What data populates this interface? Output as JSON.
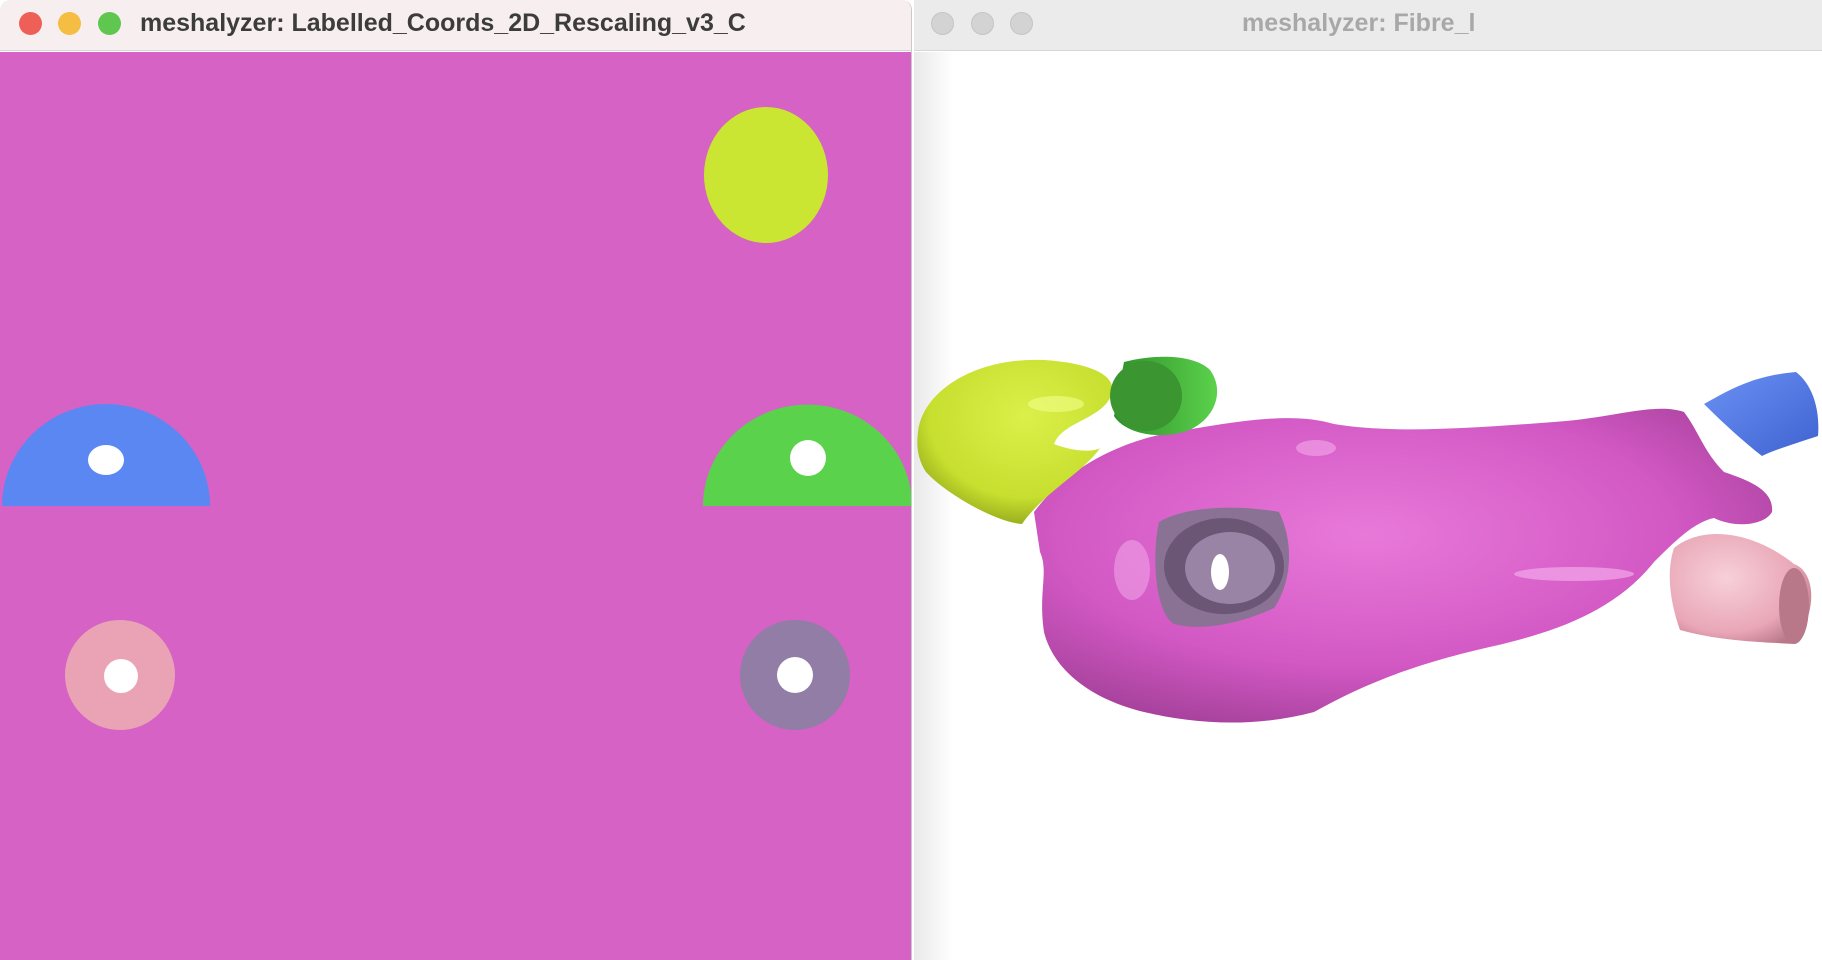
{
  "windows": {
    "left": {
      "title": "meshalyzer: Labelled_Coords_2D_Rescaling_v3_C",
      "active": true,
      "canvas_color": "#d562c4",
      "buttons": {
        "close_color": "#ee5f57",
        "minimize_color": "#f5bd42",
        "zoom_color": "#5fc650"
      },
      "regions": [
        {
          "name": "yellow-ellipse",
          "color": "#cbe632"
        },
        {
          "name": "blue-semicircle",
          "color": "#5b87f3"
        },
        {
          "name": "green-semicircle",
          "color": "#5bd24c"
        },
        {
          "name": "pink-disc",
          "color": "#e9a3b5"
        },
        {
          "name": "grey-purple-disc",
          "color": "#917da5"
        }
      ]
    },
    "right": {
      "title": "meshalyzer: Fibre_l",
      "active": false,
      "canvas_color": "#ffffff",
      "buttons": {
        "inactive_color": "#d3d3d3"
      },
      "mesh_colors": {
        "body": "#d258c4",
        "appendage": "#c7df2f",
        "green_tube": "#47b93a",
        "blue_vessel": "#4e76e6",
        "pink_vessel": "#e9a7b7",
        "grey_tube": "#8a7294"
      }
    }
  }
}
